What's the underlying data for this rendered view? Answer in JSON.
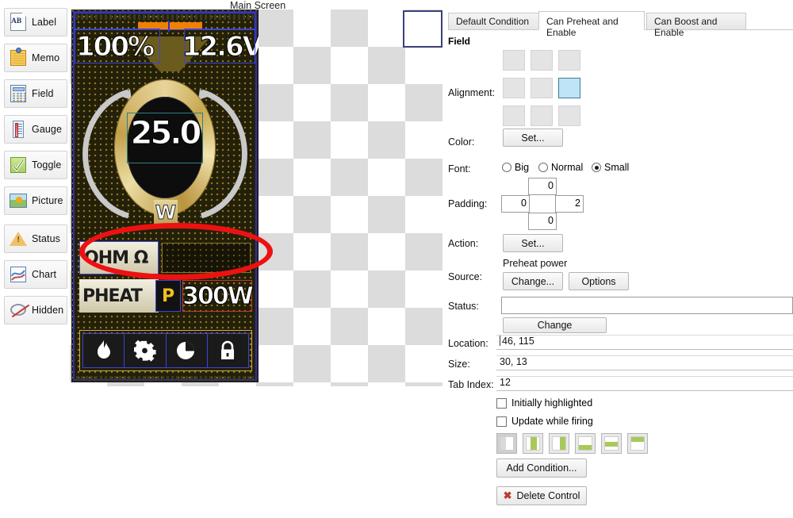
{
  "toolbox": {
    "items": [
      {
        "label": "Label",
        "icon": "label-icon"
      },
      {
        "label": "Memo",
        "icon": "memo-icon"
      },
      {
        "label": "Field",
        "icon": "field-icon"
      },
      {
        "label": "Gauge",
        "icon": "gauge-icon"
      },
      {
        "label": "Toggle",
        "icon": "toggle-icon"
      },
      {
        "label": "Picture",
        "icon": "picture-icon"
      },
      {
        "label": "Status",
        "icon": "status-icon"
      },
      {
        "label": "Chart",
        "icon": "chart-icon"
      },
      {
        "label": "Hidden",
        "icon": "hidden-icon"
      }
    ]
  },
  "canvas": {
    "title": "Main Screen"
  },
  "device": {
    "battery_percent": "100%",
    "voltage": "12.6V",
    "dial_value": "25.0",
    "dial_unit": "W",
    "rows": [
      {
        "label": "OHM Ω",
        "value": ""
      },
      {
        "label": "PHEAT",
        "badge": "P",
        "value": "300W"
      }
    ],
    "icon_bar": [
      {
        "name": "flame-icon",
        "glyph": "🔥"
      },
      {
        "name": "gear-icon",
        "glyph": "⚙"
      },
      {
        "name": "pie-chart-icon",
        "glyph": "◔"
      },
      {
        "name": "lock-icon",
        "glyph": "🔒"
      }
    ]
  },
  "annotation": {
    "shape": "red-ellipse",
    "color": "#ee1111",
    "targets_row": "OHM Ω"
  },
  "properties": {
    "tabs": [
      {
        "label": "Default Condition",
        "active": false
      },
      {
        "label": "Can Preheat and Enable",
        "active": true
      },
      {
        "label": "Can Boost and Enable",
        "active": false
      }
    ],
    "group_title": "Field",
    "alignment": {
      "label": "Alignment:",
      "selected_index": 5,
      "cells": 9
    },
    "color": {
      "label": "Color:",
      "button": "Set..."
    },
    "font": {
      "label": "Font:",
      "options": [
        "Big",
        "Normal",
        "Small"
      ],
      "selected": "Small"
    },
    "padding": {
      "label": "Padding:",
      "top": "0",
      "left": "0",
      "right": "2",
      "bottom": "0"
    },
    "action": {
      "label": "Action:",
      "button": "Set..."
    },
    "source": {
      "label": "Source:",
      "value": "Preheat power",
      "change_button": "Change...",
      "options_button": "Options"
    },
    "status": {
      "label": "Status:",
      "value": "",
      "change_button": "Change"
    },
    "location": {
      "label": "Location:",
      "value": "46, 115"
    },
    "size": {
      "label": "Size:",
      "value": "30, 13"
    },
    "tab_index": {
      "label": "Tab Index:",
      "value": "12"
    },
    "checkboxes": [
      {
        "label": "Initially highlighted",
        "checked": false
      },
      {
        "label": "Update while firing",
        "checked": false
      }
    ],
    "condition_buttons": [
      {
        "name": "condition-preset-1",
        "selected": true
      },
      {
        "name": "condition-preset-2",
        "selected": false
      },
      {
        "name": "condition-preset-3",
        "selected": false
      },
      {
        "name": "condition-preset-4",
        "selected": false
      },
      {
        "name": "condition-preset-5",
        "selected": false
      },
      {
        "name": "condition-preset-6",
        "selected": false
      }
    ],
    "add_condition_button": "Add Condition...",
    "delete_control_button": "Delete Control"
  },
  "colors": {
    "accent_selected": "#bfe3f7",
    "annotation_red": "#ee1111",
    "device_gold": "#caa84a",
    "battery_orange": "#f08000",
    "badge_yellow": "#f2c01e"
  }
}
